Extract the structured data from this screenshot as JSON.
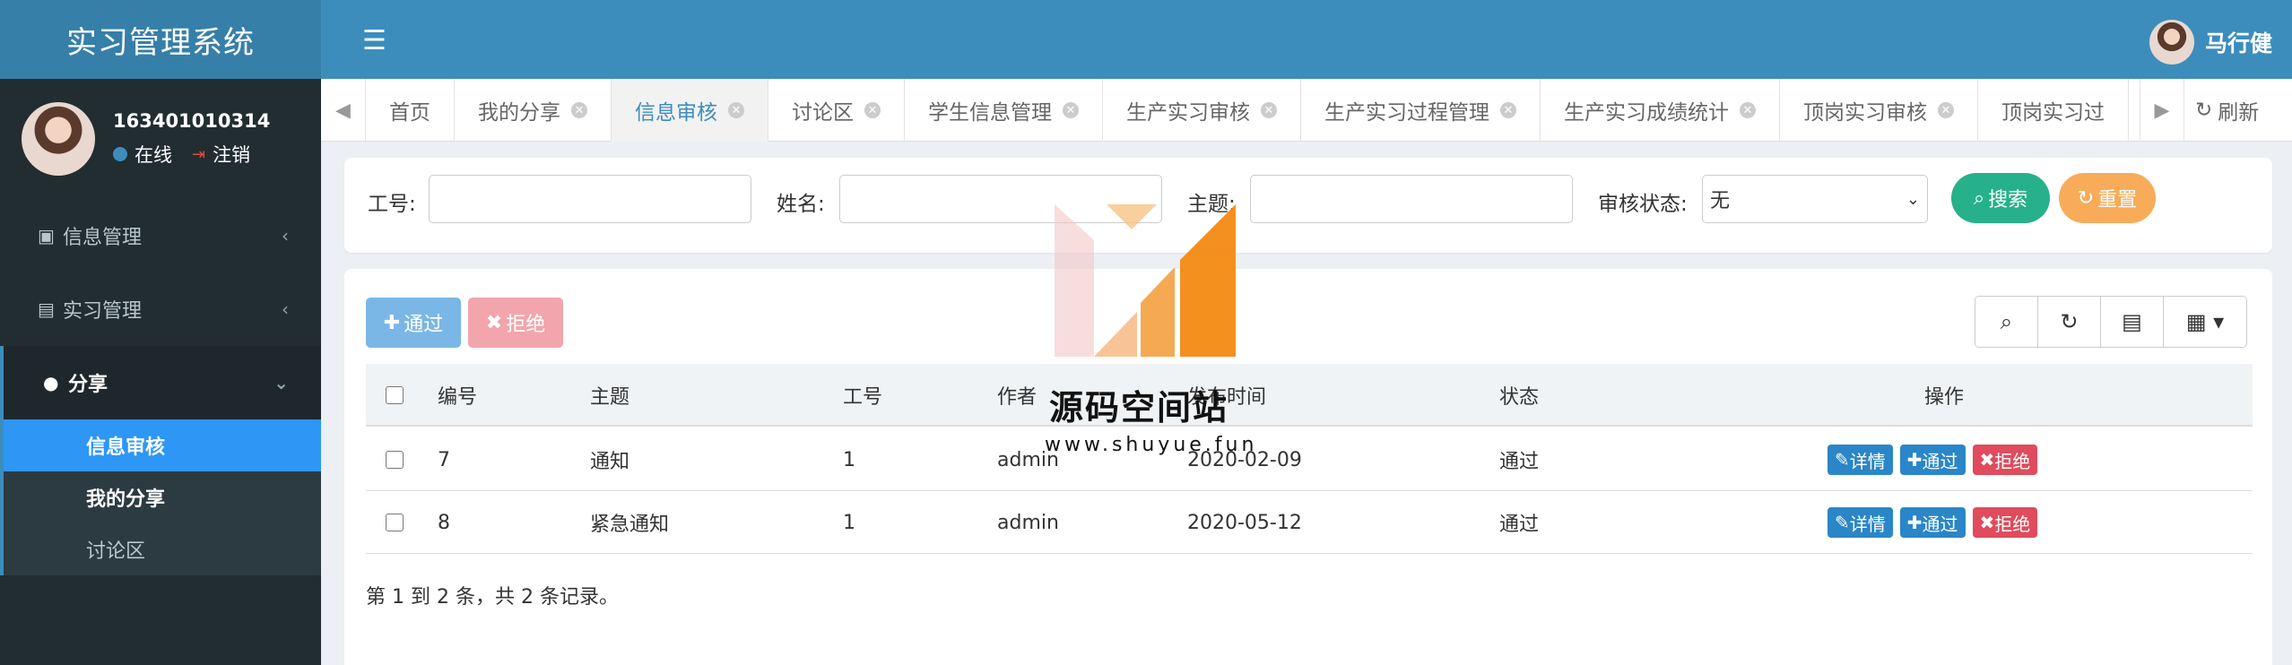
{
  "app": {
    "title": "实习管理系统"
  },
  "sidebar": {
    "user_id": "163401010314",
    "status": "在线",
    "logout": "注销",
    "menu": [
      {
        "label": "信息管理"
      },
      {
        "label": "实习管理"
      },
      {
        "label": "分享"
      }
    ],
    "submenu": [
      {
        "label": "信息审核"
      },
      {
        "label": "我的分享"
      },
      {
        "label": "讨论区"
      }
    ]
  },
  "header": {
    "user_name": "马行健"
  },
  "tabs": [
    {
      "label": "首页"
    },
    {
      "label": "我的分享"
    },
    {
      "label": "信息审核"
    },
    {
      "label": "讨论区"
    },
    {
      "label": "学生信息管理"
    },
    {
      "label": "生产实习审核"
    },
    {
      "label": "生产实习过程管理"
    },
    {
      "label": "生产实习成绩统计"
    },
    {
      "label": "顶岗实习审核"
    },
    {
      "label": "顶岗实习过"
    }
  ],
  "refresh_label": "刷新",
  "search": {
    "labels": {
      "job_no": "工号:",
      "name": "姓名:",
      "subject": "主题:",
      "status": "审核状态:"
    },
    "status_value": "无",
    "search_btn": "搜索",
    "reset_btn": "重置"
  },
  "toolbar": {
    "approve": "通过",
    "reject": "拒绝"
  },
  "table": {
    "headers": [
      "编号",
      "主题",
      "工号",
      "作者",
      "发布时间",
      "状态",
      "操作"
    ],
    "rows": [
      {
        "id": "7",
        "subject": "通知",
        "job_no": "1",
        "author": "admin",
        "time": "2020-02-09",
        "status": "通过"
      },
      {
        "id": "8",
        "subject": "紧急通知",
        "job_no": "1",
        "author": "admin",
        "time": "2020-05-12",
        "status": "通过"
      }
    ],
    "actions": {
      "detail": "详情",
      "approve": "通过",
      "reject": "拒绝"
    },
    "footer": "第 1 到 2 条，共 2 条记录。"
  },
  "watermark": {
    "title": "源码空间站",
    "url": "www.shuyue.fun"
  },
  "colors": {
    "header": "#3c8dbc",
    "sidebar": "#222d32",
    "search": "#26b18a",
    "reset": "#f8ac59",
    "approve": "#7ab7e6",
    "reject": "#f2a5ad"
  }
}
